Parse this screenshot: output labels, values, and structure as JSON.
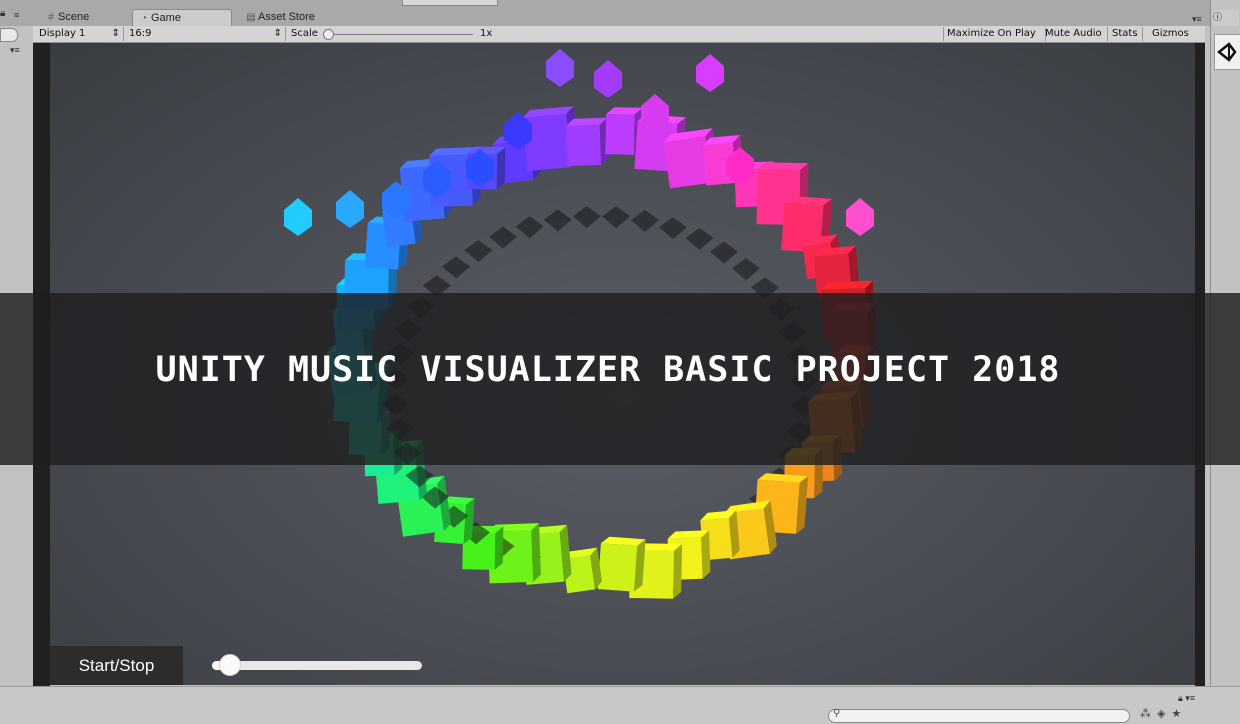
{
  "tabs": [
    {
      "label": "Scene",
      "icon": "grid-icon"
    },
    {
      "label": "Game",
      "icon": "pacman-icon"
    },
    {
      "label": "Asset Store",
      "icon": "store-icon"
    }
  ],
  "toolbar": {
    "display": "Display 1",
    "aspect": "16:9",
    "scale_label": "Scale",
    "scale_value": "1x",
    "maximize_on_play": "Maximize On Play",
    "mute_audio": "Mute Audio",
    "stats": "Stats",
    "gizmos": "Gizmos"
  },
  "banner": {
    "title": "UNITY MUSIC VISUALIZER BASIC PROJECT 2018"
  },
  "game_ui": {
    "start_stop_label": "Start/Stop",
    "volume_slider_level": 0.05
  },
  "colors": {
    "banner_bg": "#1e1f21",
    "viewport_bg": "#4a4d53",
    "cube_gradient": [
      "#5f3bff",
      "#c23cff",
      "#ff3bd1",
      "#ff2a5a",
      "#c81e1e",
      "#e0661a",
      "#ffb21a",
      "#f2f21a",
      "#b8f21a",
      "#3cf21a",
      "#1af28a",
      "#1ad6d6",
      "#1aa8ff",
      "#3a6bff"
    ]
  }
}
